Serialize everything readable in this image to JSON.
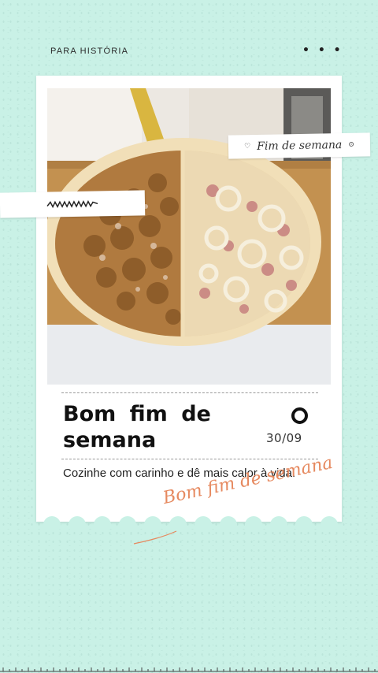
{
  "header": {
    "label": "PARA HISTÓRIA",
    "menu_icon": "more-dots-icon"
  },
  "card": {
    "photo_alt": "pizza-photo",
    "tape_right_text": "Fim de semana",
    "tape_right_left_icon": "heart-icon",
    "tape_right_right_icon": "circle-icon",
    "tape_left_icon": "scribble-icon",
    "title_line1": "Bom fim de",
    "title_line2": "semana",
    "date": "30/09",
    "subtitle": "Cozinhe com carinho e dê mais calor à vida."
  },
  "script_text": "Bom fim de semana",
  "colors": {
    "background": "#c9f1e6",
    "card": "#ffffff",
    "accent_script": "#e6895f",
    "title": "#111111"
  }
}
